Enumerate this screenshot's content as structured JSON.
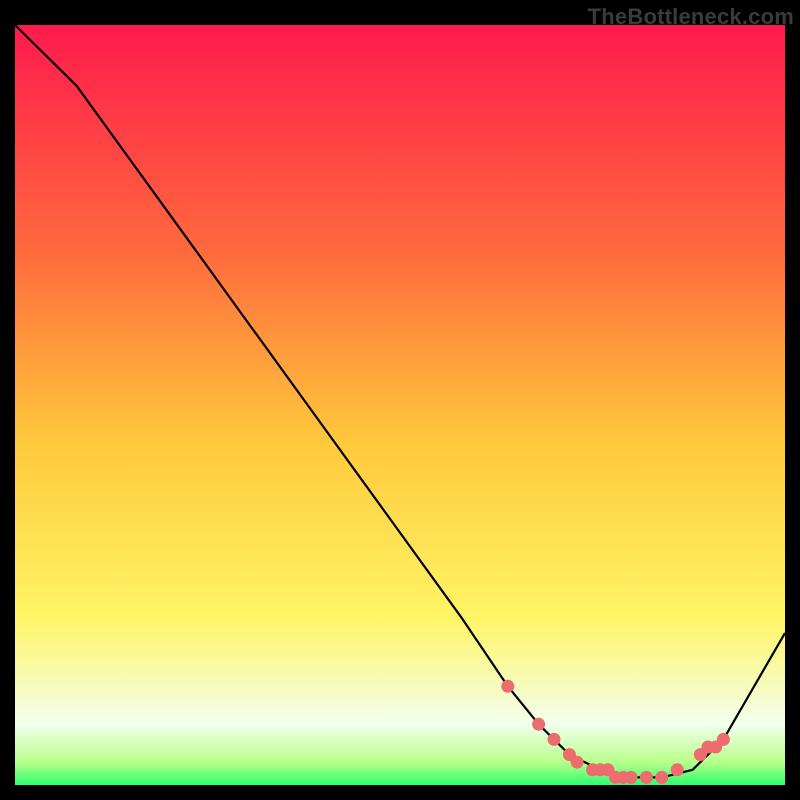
{
  "watermark": "TheBottleneck.com",
  "chart_data": {
    "type": "line",
    "title": "",
    "xlabel": "",
    "ylabel": "",
    "xlim": [
      0,
      100
    ],
    "ylim": [
      0,
      100
    ],
    "grid": false,
    "legend": false,
    "gradient_stops": [
      {
        "offset": 0.0,
        "color": "#ff1a4d"
      },
      {
        "offset": 0.3,
        "color": "#ff6a3d"
      },
      {
        "offset": 0.55,
        "color": "#ffc93c"
      },
      {
        "offset": 0.78,
        "color": "#fff566"
      },
      {
        "offset": 0.92,
        "color": "#f2ffed"
      },
      {
        "offset": 0.97,
        "color": "#b8ff8a"
      },
      {
        "offset": 1.0,
        "color": "#2dff6e"
      }
    ],
    "curve": {
      "x": [
        0,
        8,
        18,
        28,
        38,
        48,
        58,
        64,
        68,
        72,
        76,
        80,
        84,
        88,
        92,
        96,
        100
      ],
      "y": [
        100,
        92,
        78,
        64,
        50,
        36,
        22,
        13,
        8,
        4,
        2,
        1,
        1,
        2,
        6,
        13,
        20
      ]
    },
    "dots": {
      "x": [
        64,
        68,
        70,
        72,
        73,
        75,
        76,
        77,
        78,
        79,
        80,
        82,
        84,
        86,
        89,
        90,
        91,
        92
      ],
      "y": [
        13,
        8,
        6,
        4,
        3,
        2,
        2,
        2,
        1,
        1,
        1,
        1,
        1,
        2,
        4,
        5,
        5,
        6
      ]
    }
  }
}
